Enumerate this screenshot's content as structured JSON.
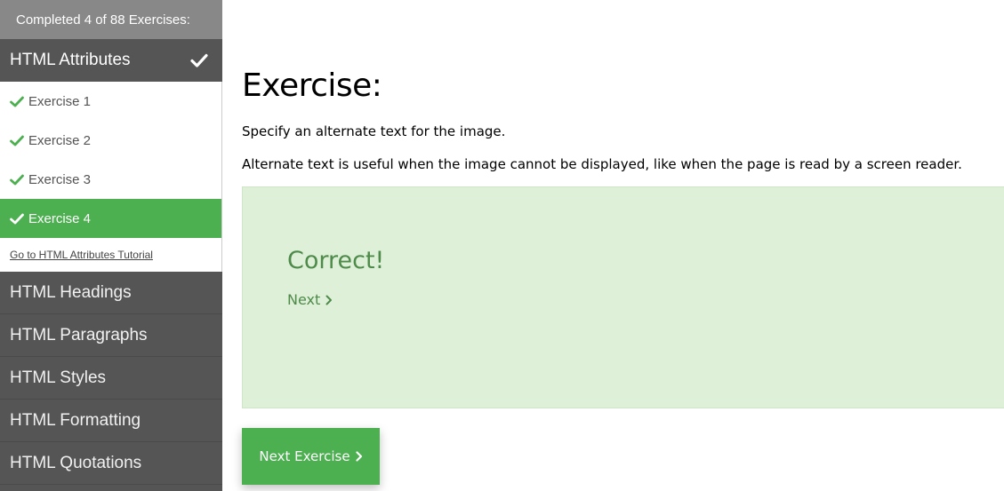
{
  "sidebar": {
    "progress_text": "Completed 4 of 88 Exercises:",
    "active_section": {
      "label": "HTML Attributes",
      "completed_icon": "check-icon"
    },
    "exercises": [
      {
        "label": "Exercise 1",
        "done": true,
        "active": false
      },
      {
        "label": "Exercise 2",
        "done": true,
        "active": false
      },
      {
        "label": "Exercise 3",
        "done": true,
        "active": false
      },
      {
        "label": "Exercise 4",
        "done": true,
        "active": true
      }
    ],
    "tutorial_link": "Go to HTML Attributes Tutorial",
    "sections": [
      "HTML Headings",
      "HTML Paragraphs",
      "HTML Styles",
      "HTML Formatting",
      "HTML Quotations"
    ]
  },
  "main": {
    "title": "Exercise:",
    "instruction": "Specify an alternate text for the image.",
    "explanation": "Alternate text is useful when the image cannot be displayed, like when the page is read by a screen reader.",
    "result": {
      "message": "Correct!",
      "next_label": "Next"
    },
    "next_exercise_label": "Next Exercise"
  },
  "colors": {
    "accent_green": "#4caf50",
    "sidebar_dark": "#555555",
    "success_bg": "#dff0d8",
    "success_text": "#4e8a4a"
  }
}
